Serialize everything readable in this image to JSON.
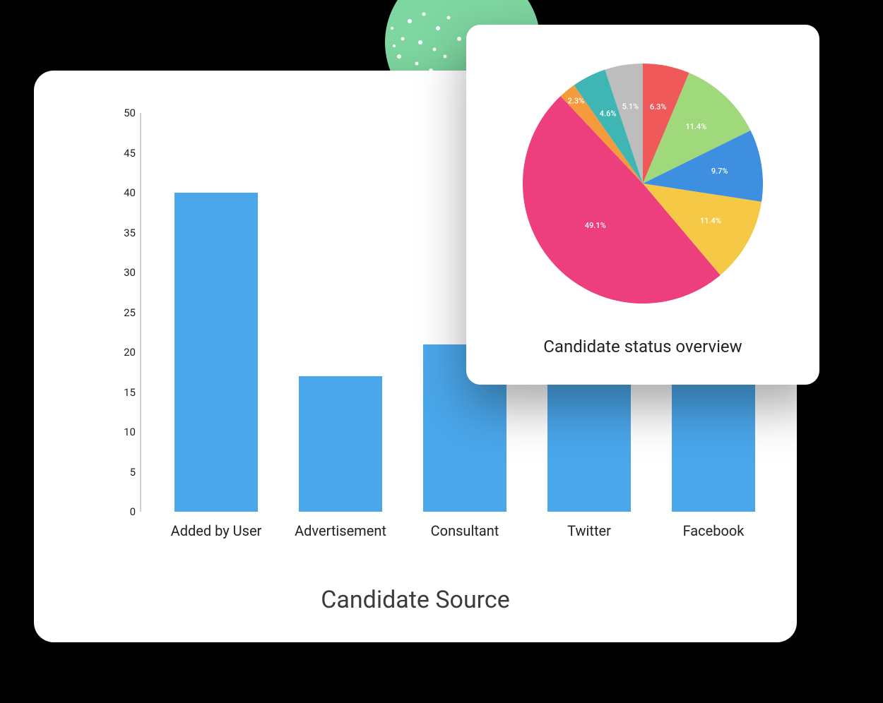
{
  "bar_chart": {
    "title": "Candidate Source",
    "ymax": 50,
    "yticks": [
      0,
      5,
      10,
      15,
      20,
      25,
      30,
      35,
      40,
      45,
      50
    ]
  },
  "pie_chart": {
    "title": "Candidate status overview"
  },
  "chart_data": [
    {
      "type": "bar",
      "title": "Candidate Source",
      "categories": [
        "Added by User",
        "Advertisement",
        "Consultant",
        "Twitter",
        "Facebook"
      ],
      "values": [
        40,
        17,
        21,
        16,
        16
      ],
      "ylim": [
        0,
        50
      ],
      "xlabel": "",
      "ylabel": ""
    },
    {
      "type": "pie",
      "title": "Candidate status overview",
      "series": [
        {
          "name": "slice-1",
          "value": 6.3,
          "label": "6.3%",
          "color": "#f05959"
        },
        {
          "name": "slice-2",
          "value": 11.4,
          "label": "11.4%",
          "color": "#9fd97b"
        },
        {
          "name": "slice-3",
          "value": 9.7,
          "label": "9.7%",
          "color": "#3f8fe0"
        },
        {
          "name": "slice-4",
          "value": 11.4,
          "label": "11.4%",
          "color": "#f5c945"
        },
        {
          "name": "slice-5",
          "value": 49.1,
          "label": "49.1%",
          "color": "#ed3e7d"
        },
        {
          "name": "slice-6",
          "value": 2.3,
          "label": "2.3%",
          "color": "#f59b3c"
        },
        {
          "name": "slice-7",
          "value": 4.6,
          "label": "4.6%",
          "color": "#3fb6b3"
        },
        {
          "name": "slice-8",
          "value": 5.1,
          "label": "5.1%",
          "color": "#bdbdbd"
        }
      ]
    }
  ]
}
